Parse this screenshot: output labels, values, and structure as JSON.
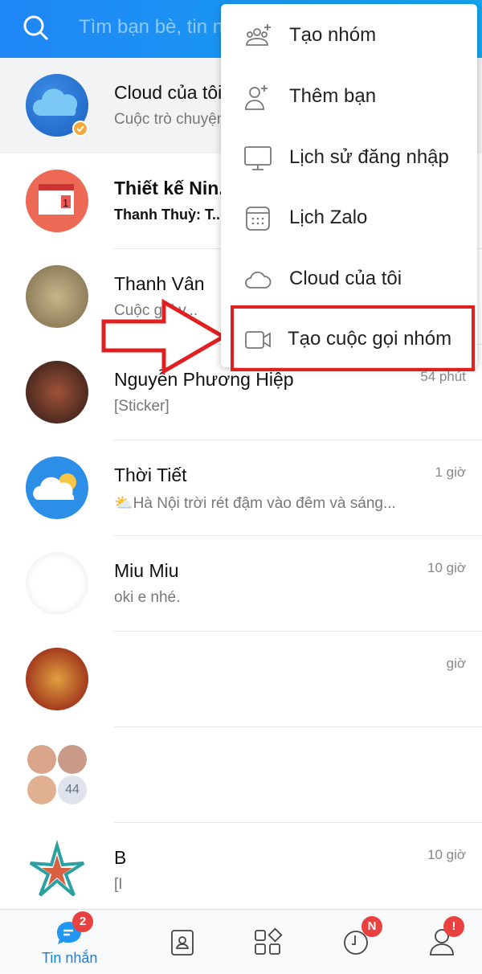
{
  "search": {
    "placeholder": "Tìm bạn bè, tin nhắn..."
  },
  "conversations": [
    {
      "name": "Cloud của tôi",
      "message": "Cuộc trò chuyện",
      "time": ""
    },
    {
      "name": "Thiết kế Nin...",
      "message": "Thanh Thuỳ: T...",
      "time": ""
    },
    {
      "name": "Thanh Vân",
      "message": "Cuộc gọi v...",
      "time": ""
    },
    {
      "name": "Nguyễn Phương Hiệp",
      "message": "[Sticker]",
      "time": "54 phút"
    },
    {
      "name": "Thời Tiết",
      "message": "⛅Hà Nội trời rét đậm vào đêm và sáng...",
      "time": "1 giờ"
    },
    {
      "name": "Miu Miu",
      "message": "oki e nhé.",
      "time": "10 giờ"
    },
    {
      "name": "",
      "message": "",
      "time": "giờ"
    },
    {
      "name": "",
      "message": "",
      "time": "",
      "group_count": "44"
    },
    {
      "name": "B",
      "message": "[I",
      "time": "10 giờ"
    }
  ],
  "menu": {
    "items": [
      {
        "label": "Tạo nhóm",
        "icon": "group-add-icon"
      },
      {
        "label": "Thêm bạn",
        "icon": "person-add-icon"
      },
      {
        "label": "Lịch sử đăng nhập",
        "icon": "monitor-icon"
      },
      {
        "label": "Lịch Zalo",
        "icon": "calendar-icon"
      },
      {
        "label": "Cloud của tôi",
        "icon": "cloud-icon"
      },
      {
        "label": "Tạo cuộc gọi nhóm",
        "icon": "video-call-icon",
        "highlighted": true
      }
    ]
  },
  "nav": {
    "messages_label": "Tin nhắn",
    "messages_badge": "2",
    "timeline_badge": "N",
    "profile_badge": "!"
  },
  "colors": {
    "header": "#1f86f5",
    "highlight": "#e02020",
    "badge": "#e94040",
    "active": "#1a7fd8"
  }
}
